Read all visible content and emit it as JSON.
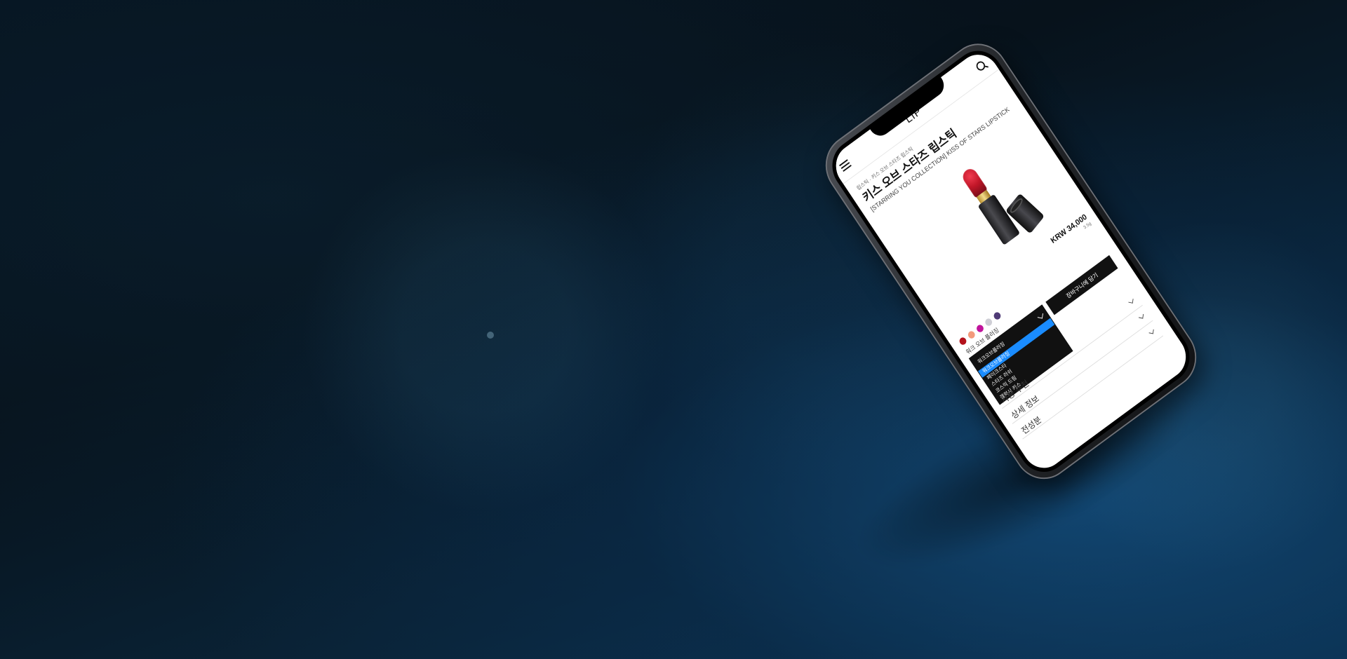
{
  "app": {
    "page_title": "LIP"
  },
  "product": {
    "breadcrumb": "립스틱 · 키스 오브 스타즈 립스틱",
    "title_ko": "키스 오브 스타즈 립스틱",
    "title_en": "[STARRING YOU COLLECTION] KISS OF STARS LIPSTICK",
    "price": "KRW 34,000",
    "volume": "3.5g",
    "selected_shade_name": "워크 오브 플러징",
    "image_icon": "lipstick-icon"
  },
  "colors": {
    "accent": "#1a8cff",
    "swatches": [
      "#b3121c",
      "#f39a7c",
      "#c0139b",
      "#cfcfd6",
      "#4f3b76"
    ]
  },
  "selector": {
    "selected": "워크오브플러징",
    "options": [
      "워크오브플러징",
      "페이크스타",
      "스타즈 러쉬",
      "코스믹 드림",
      "갤럭시 키스"
    ]
  },
  "actions": {
    "cart_button": "장바구니에 담기"
  },
  "accordion": {
    "items": [
      "사용 추천",
      "상세 정보",
      "전성분"
    ]
  },
  "icons": {
    "menu": "menu-icon",
    "search": "search-icon"
  }
}
